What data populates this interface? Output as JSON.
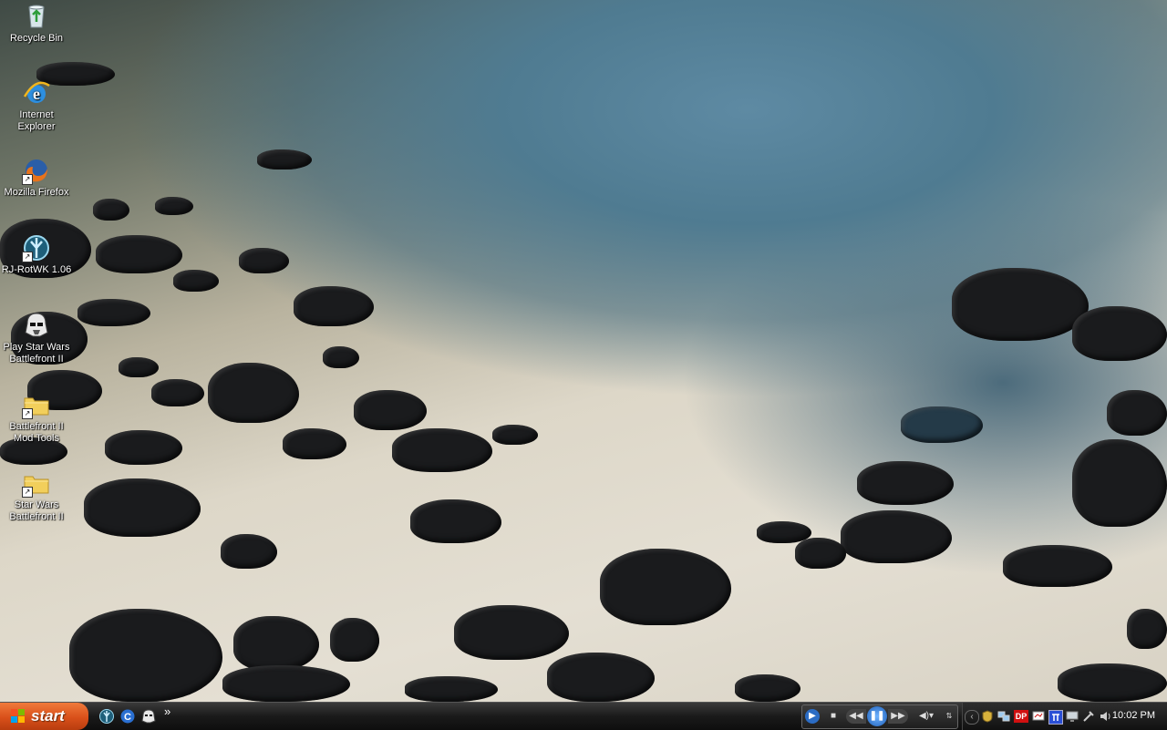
{
  "desktop": {
    "icons": [
      {
        "label_line1": "Recycle Bin",
        "label_line2": "",
        "icon": "recycle-bin-icon",
        "shortcut": false
      },
      {
        "label_line1": "Internet",
        "label_line2": "Explorer",
        "icon": "internet-explorer-icon",
        "shortcut": false
      },
      {
        "label_line1": "Mozilla Firefox",
        "label_line2": "",
        "icon": "firefox-icon",
        "shortcut": true
      },
      {
        "label_line1": "RJ-RotWK 1.06",
        "label_line2": "",
        "icon": "rotwk-game-icon",
        "shortcut": true
      },
      {
        "label_line1": "Play Star Wars",
        "label_line2": "Battlefront II",
        "icon": "stormtrooper-helmet-icon",
        "shortcut": false
      },
      {
        "label_line1": "Battlefront II",
        "label_line2": "Mod Tools",
        "icon": "folder-icon",
        "shortcut": true
      },
      {
        "label_line1": "Star Wars",
        "label_line2": "Battlefront II",
        "icon": "folder-icon",
        "shortcut": true
      }
    ]
  },
  "taskbar": {
    "start_label": "start",
    "quick_launch": [
      {
        "icon": "rotwk-quicklaunch-icon"
      },
      {
        "icon": "ccleaner-icon"
      },
      {
        "icon": "stormtrooper-quicklaunch-icon"
      }
    ],
    "overflow_label": "»",
    "media_player": {
      "buttons": [
        "play-icon",
        "stop-icon",
        "previous-icon",
        "pause-icon",
        "next-icon",
        "volume-icon"
      ]
    },
    "tray_icons": [
      "tray-expand-icon",
      "security-icon",
      "network-icon",
      "dp-icon",
      "display-icon",
      "nvidia-icon",
      "monitor-icon",
      "usb-icon",
      "speaker-icon"
    ],
    "tray_dp_label": "DP",
    "clock": "10:02 PM"
  },
  "colors": {
    "start_orange": "#d9501a",
    "taskbar_dark": "#1a1a1a",
    "folder_yellow": "#f2cf5b"
  }
}
